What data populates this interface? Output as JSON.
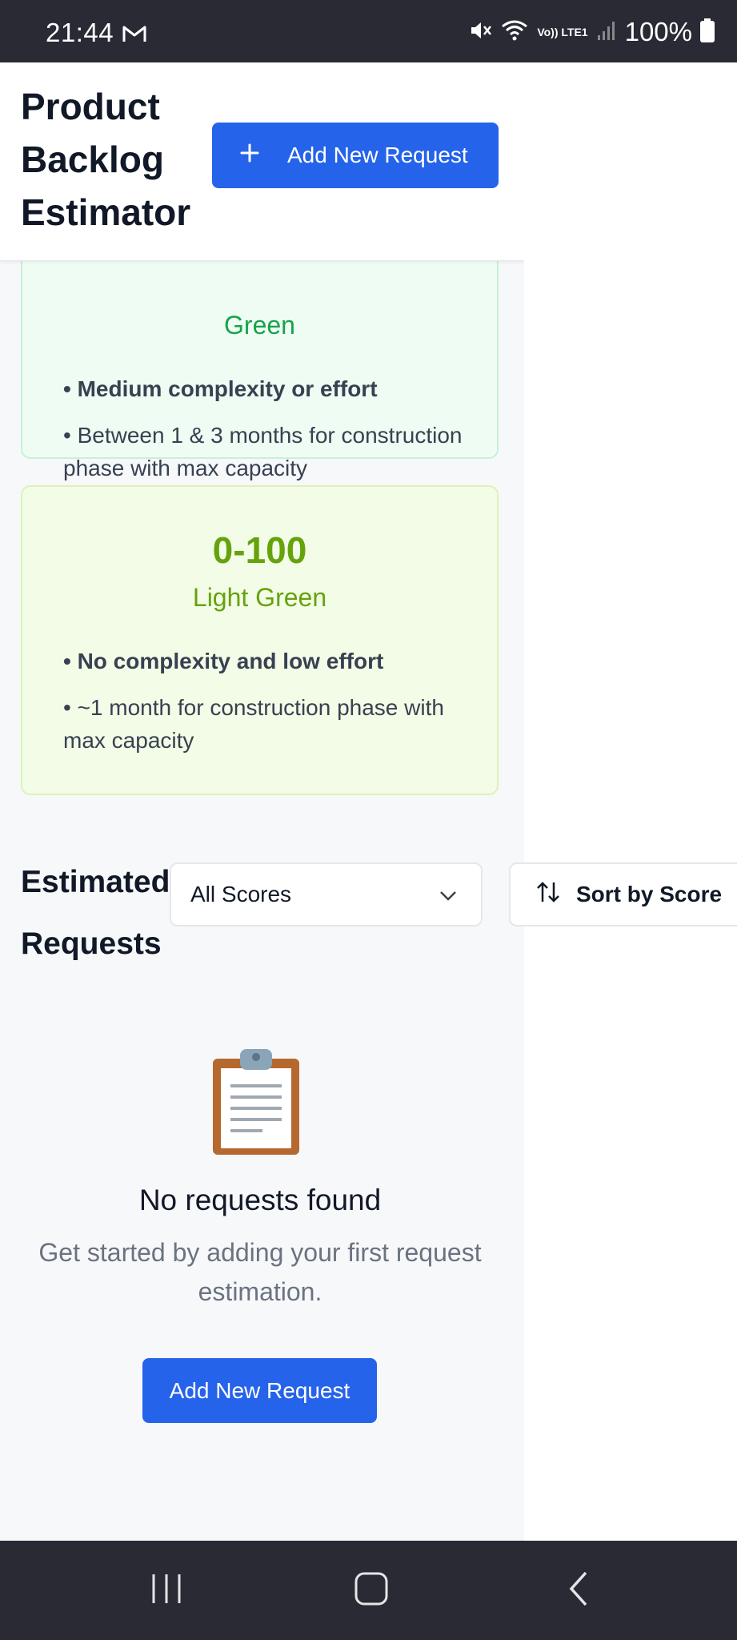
{
  "status_bar": {
    "time": "21:44",
    "battery_text": "100%",
    "network_text": "Vo)) LTE1",
    "icons": [
      "gmail-icon",
      "mute-icon",
      "wifi-icon",
      "signal-icon",
      "battery-icon"
    ]
  },
  "header": {
    "title": "Product Backlog Estimator",
    "add_button_label": "Add New Request",
    "add_button_icon": "+"
  },
  "score_cards": [
    {
      "range": "",
      "label": "Green",
      "color": "#16a34a",
      "bullets": [
        "• Medium complexity or effort",
        "• Between 1 & 3 months for construction phase with max capacity"
      ]
    },
    {
      "range": "0-100",
      "label": "Light Green",
      "color": "#65a30d",
      "bullets": [
        "• No complexity and low effort",
        "• ~1 month for construction phase with max capacity"
      ]
    }
  ],
  "requests_section": {
    "title": "Estimated Requests",
    "filter": {
      "selected": "All Scores"
    },
    "sort_button_label": "Sort by Score"
  },
  "empty_state": {
    "icon": "clipboard-icon",
    "title": "No requests found",
    "subtitle": "Get started by adding your first request estimation.",
    "button_label": "Add New Request"
  },
  "colors": {
    "primary": "#2563eb",
    "green_card_bg": "#eefcf3",
    "light_green_card_bg": "#f3fce6"
  }
}
